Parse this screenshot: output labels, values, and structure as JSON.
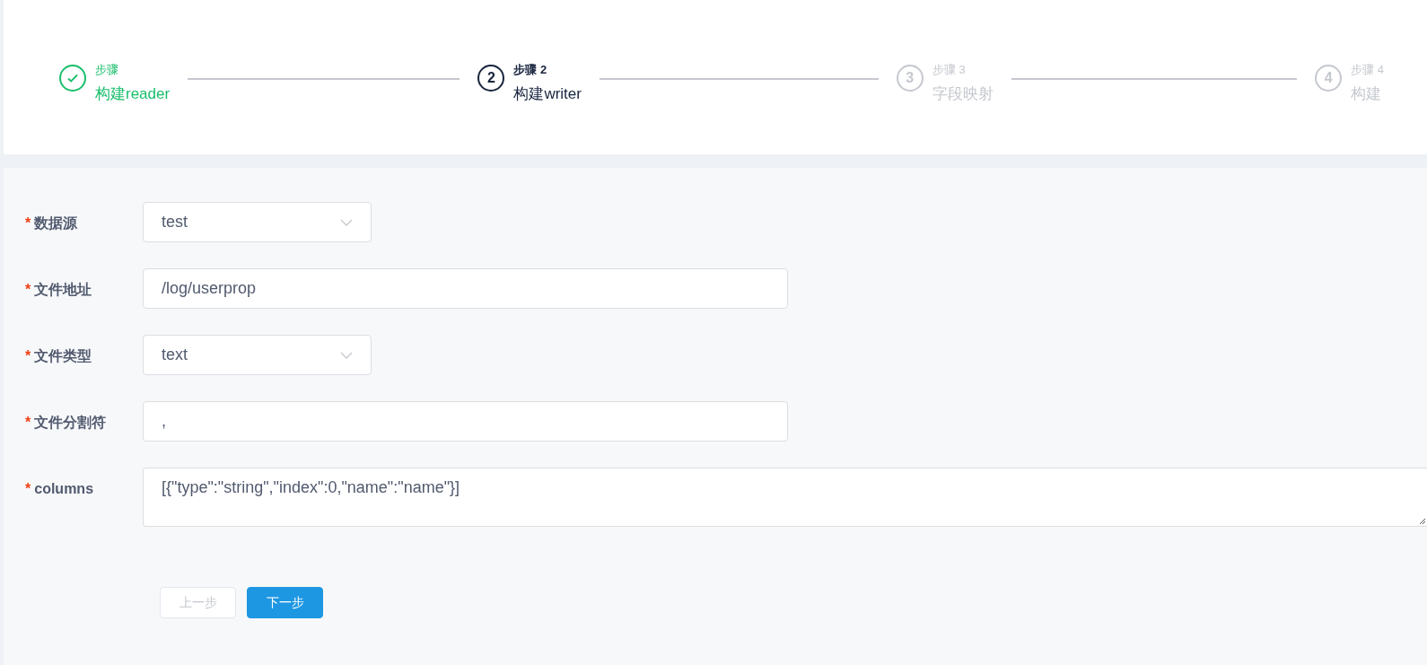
{
  "steps": [
    {
      "done": true,
      "selected": false,
      "caption": "步骤",
      "title": "构建reader"
    },
    {
      "done": false,
      "selected": true,
      "number": "2",
      "caption": "步骤 2",
      "title": "构建writer"
    },
    {
      "done": false,
      "selected": false,
      "number": "3",
      "caption": "步骤 3",
      "title": "字段映射"
    },
    {
      "done": false,
      "selected": false,
      "number": "4",
      "caption": "步骤 4",
      "title": "构建"
    }
  ],
  "form": [
    {
      "kind": "select",
      "required_mark": "*",
      "label": "数据源",
      "value": "test"
    },
    {
      "kind": "input",
      "required_mark": "*",
      "label": "文件地址",
      "value": "/log/userprop"
    },
    {
      "kind": "select",
      "required_mark": "*",
      "label": "文件类型",
      "value": "text"
    },
    {
      "kind": "input",
      "required_mark": "*",
      "label": "文件分割符",
      "value": ","
    },
    {
      "kind": "textarea",
      "required_mark": "*",
      "label": "columns",
      "value": "[{\"type\":\"string\",\"index\":0,\"name\":\"name\"}]"
    }
  ],
  "buttons": [
    {
      "label": "上一步",
      "kind": "default",
      "disabled": true
    },
    {
      "label": "下一步",
      "kind": "primary",
      "disabled": false
    }
  ]
}
